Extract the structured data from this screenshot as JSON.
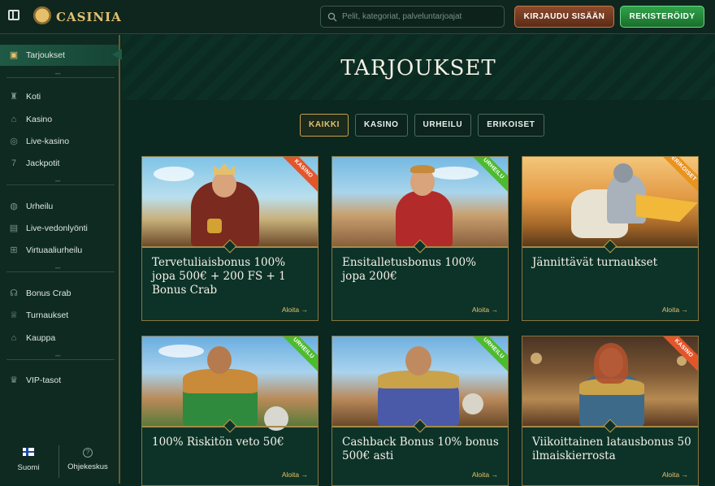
{
  "header": {
    "brand": "CASINIA",
    "search_placeholder": "Pelit, kategoriat, palveluntarjoajat",
    "login_label": "KIRJAUDU SISÄÄN",
    "register_label": "REKISTERÖIDY"
  },
  "sidebar": {
    "top": [
      {
        "label": "Tarjoukset",
        "icon": "chest-icon"
      }
    ],
    "group1": [
      {
        "label": "Koti",
        "icon": "castle-icon"
      },
      {
        "label": "Kasino",
        "icon": "building-icon"
      },
      {
        "label": "Live-kasino",
        "icon": "chip-icon"
      },
      {
        "label": "Jackpotit",
        "icon": "seven-icon"
      }
    ],
    "group2": [
      {
        "label": "Urheilu",
        "icon": "ball-icon"
      },
      {
        "label": "Live-vedonlyönti",
        "icon": "live-icon"
      },
      {
        "label": "Virtuaaliurheilu",
        "icon": "gamepad-icon"
      }
    ],
    "group3": [
      {
        "label": "Bonus Crab",
        "icon": "crab-icon"
      },
      {
        "label": "Turnaukset",
        "icon": "trophy-icon"
      },
      {
        "label": "Kauppa",
        "icon": "shop-icon"
      }
    ],
    "group4": [
      {
        "label": "VIP-tasot",
        "icon": "crown-icon"
      }
    ],
    "footer": {
      "language": "Suomi",
      "help": "Ohjekeskus"
    }
  },
  "main": {
    "title": "TARJOUKSET",
    "tabs": [
      "KAIKKI",
      "KASINO",
      "URHEILU",
      "ERIKOISET"
    ],
    "active_tab": "KAIKKI",
    "cards": [
      {
        "title": "Tervetuliaisbonus 100% jopa 500€ + 200 FS + 1 Bonus Crab",
        "badge": "KASINO",
        "cta": "Aloita →"
      },
      {
        "title": "Ensitalletusbonus 100% jopa 200€",
        "badge": "URHEILU",
        "cta": "Aloita →"
      },
      {
        "title": "Jännittävät turnaukset",
        "badge": "ERIKOISET",
        "cta": "Aloita →"
      },
      {
        "title": "100% Riskitön veto 50€",
        "badge": "URHEILU",
        "cta": "Aloita →"
      },
      {
        "title": "Cashback Bonus 10% bonus 500€ asti",
        "badge": "URHEILU",
        "cta": "Aloita →"
      },
      {
        "title": "Viikoittainen latausbonus 50 ilmaiskierrosta",
        "badge": "KASINO",
        "cta": "Aloita →"
      }
    ]
  },
  "colors": {
    "gold": "#e4c06d",
    "casino_badge": "#e4552a",
    "sport_badge": "#4dbb2e",
    "special_badge": "#e9931f",
    "register_green": "#2fa34a",
    "login_brown": "#8b4a2c"
  }
}
